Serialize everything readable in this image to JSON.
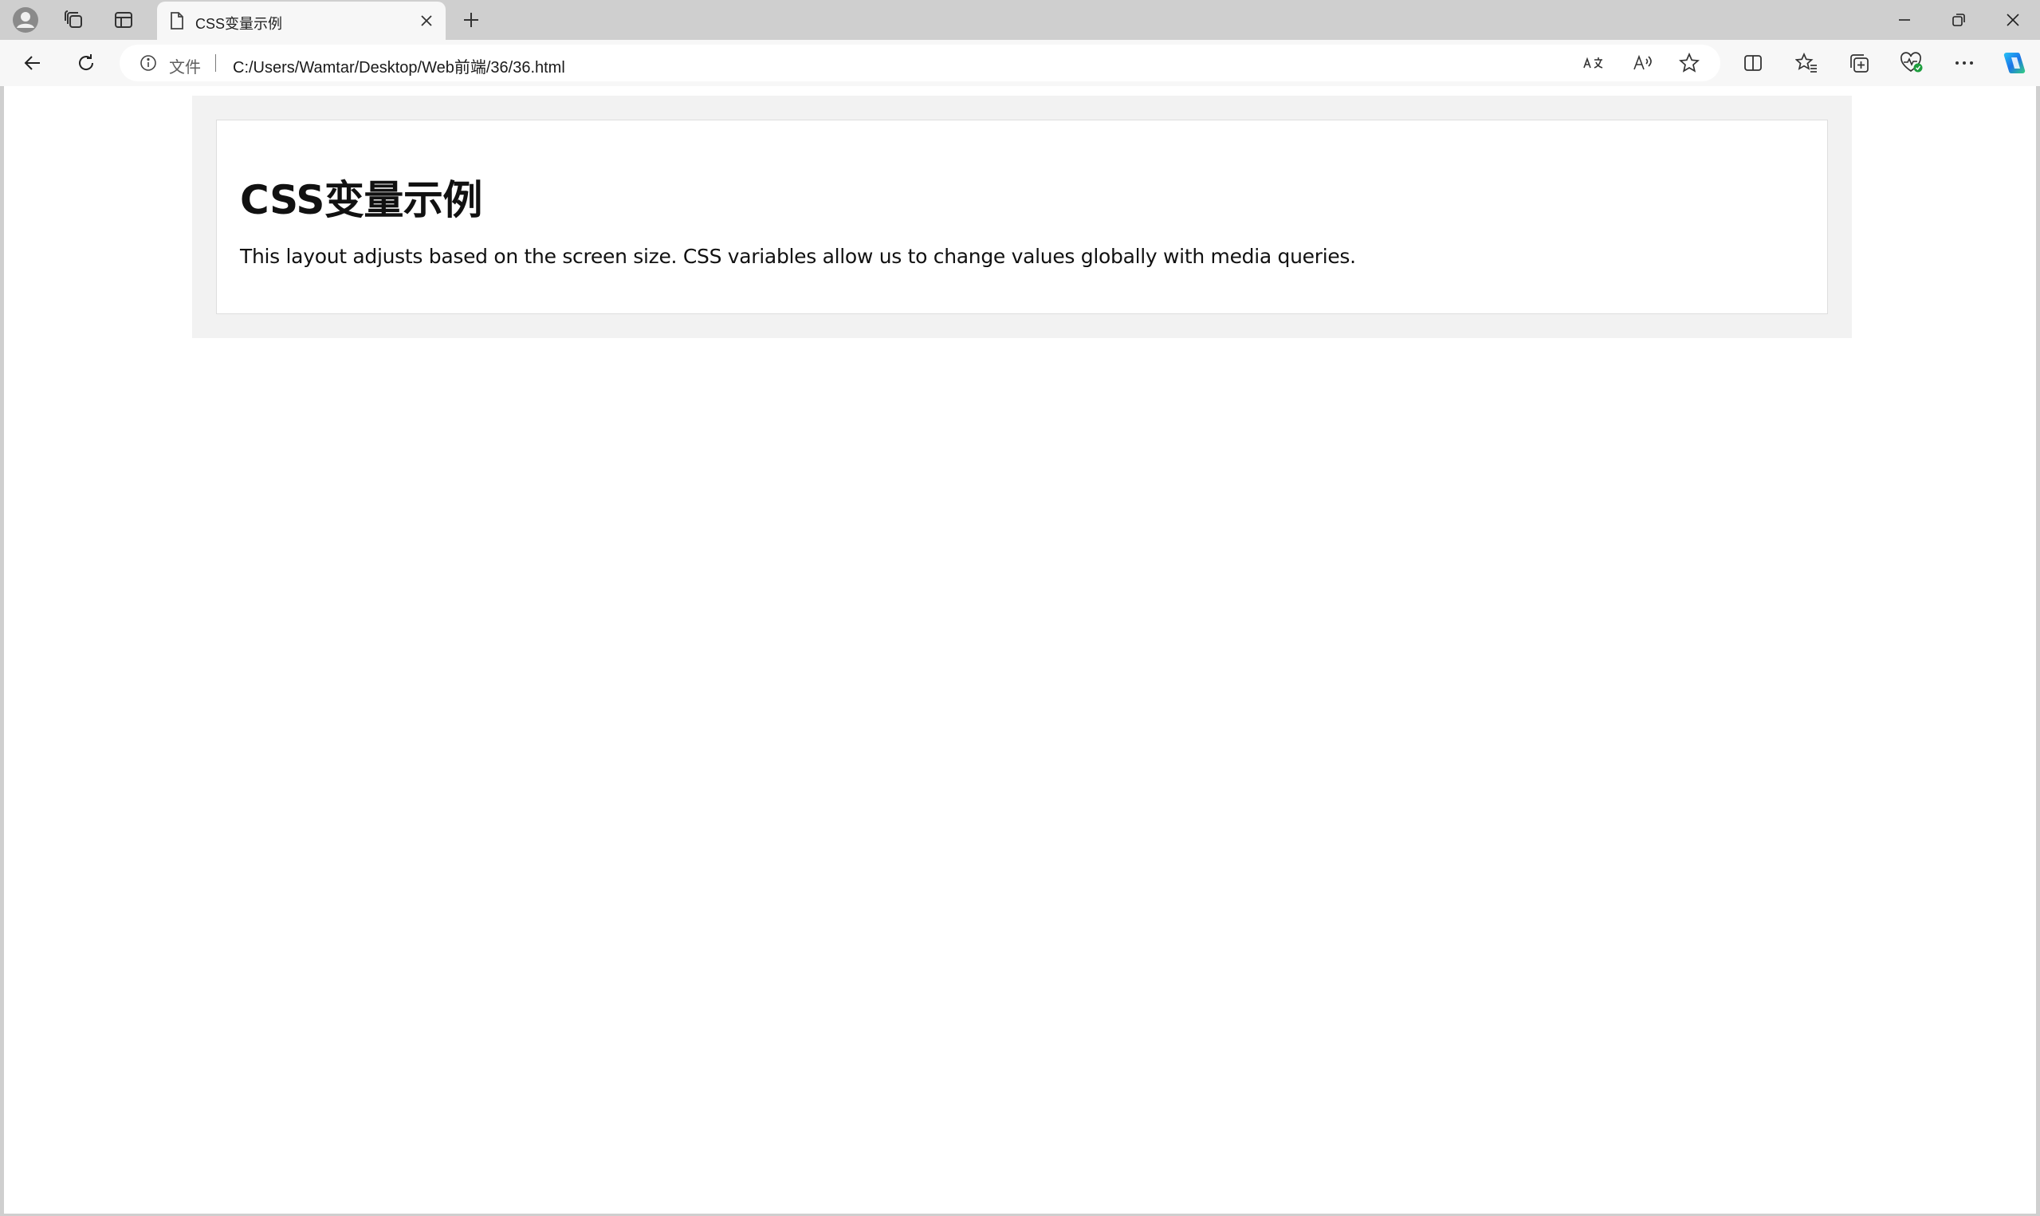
{
  "browser": {
    "tab": {
      "title": "CSS变量示例"
    },
    "address_bar": {
      "label": "文件",
      "url": "C:/Users/Wamtar/Desktop/Web前端/36/36.html"
    },
    "icons": {
      "profile": "profile-icon",
      "workspaces": "workspaces-icon",
      "tab_actions": "vertical-tabs-icon",
      "page": "page-icon",
      "close_tab": "close-icon",
      "new_tab": "plus-icon",
      "minimize": "minimize-icon",
      "restore": "restore-icon",
      "close_window": "close-icon",
      "back": "back-arrow-icon",
      "refresh": "refresh-icon",
      "info": "info-icon",
      "translate": "translate-icon",
      "read_aloud": "read-aloud-icon",
      "favorite": "star-icon",
      "split_screen": "split-screen-icon",
      "favorites": "favorites-icon",
      "collections": "collections-icon",
      "browser_essentials": "heart-pulse-icon",
      "more": "more-icon",
      "copilot": "copilot-icon"
    },
    "colors": {
      "tabstrip": "#cfcfcf",
      "toolbar": "#f7f7f7",
      "copilot_blue": "#1a73e8",
      "status_green": "#1e9e3e"
    }
  },
  "page": {
    "heading": "CSS变量示例",
    "paragraph": "This layout adjusts based on the screen size. CSS variables allow us to change values globally with media queries.",
    "colors": {
      "container_bg": "#f2f2f2",
      "card_bg": "#ffffff",
      "card_border": "#dedede"
    }
  }
}
